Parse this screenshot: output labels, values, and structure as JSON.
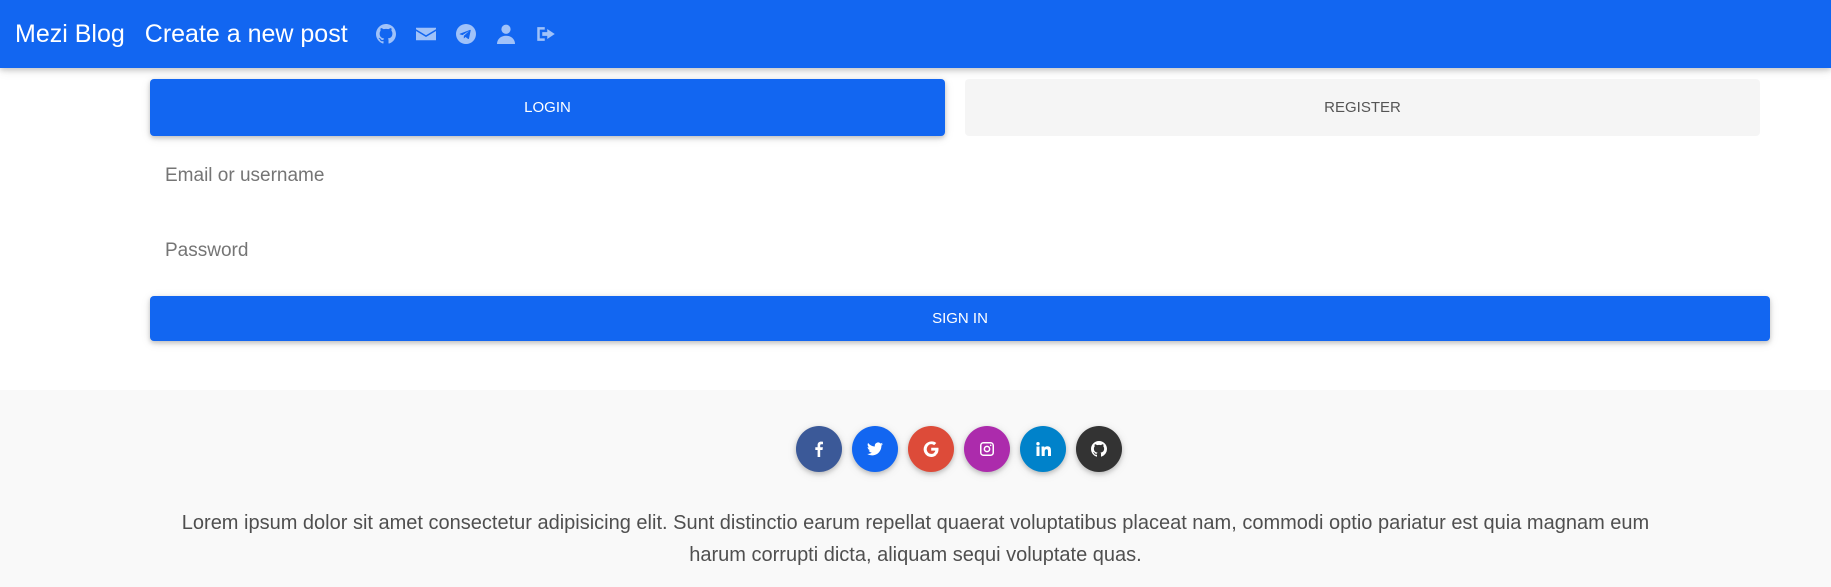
{
  "navbar": {
    "brand": "Mezi Blog",
    "create_post": "Create a new post",
    "icons": [
      "github-icon",
      "envelope-icon",
      "telegram-icon",
      "user-icon",
      "sign-out-icon"
    ]
  },
  "auth": {
    "tabs": [
      {
        "label": "LOGIN",
        "active": true
      },
      {
        "label": "REGISTER",
        "active": false
      }
    ],
    "email_placeholder": "Email or username",
    "password_placeholder": "Password",
    "submit_label": "SIGN IN"
  },
  "footer": {
    "social": [
      {
        "name": "facebook",
        "color": "#3b5998"
      },
      {
        "name": "twitter",
        "color": "#1266f1"
      },
      {
        "name": "google",
        "color": "#dd4b39"
      },
      {
        "name": "instagram",
        "color": "#ac2bac"
      },
      {
        "name": "linkedin",
        "color": "#0082ca"
      },
      {
        "name": "github",
        "color": "#333333"
      }
    ],
    "text": "Lorem ipsum dolor sit amet consectetur adipisicing elit. Sunt distinctio earum repellat quaerat voluptatibus placeat nam, commodi optio pariatur est quia magnam eum harum corrupti dicta, aliquam sequi voluptate quas."
  },
  "colors": {
    "primary": "#1266f1",
    "footer_bg": "#f9f9f9"
  }
}
